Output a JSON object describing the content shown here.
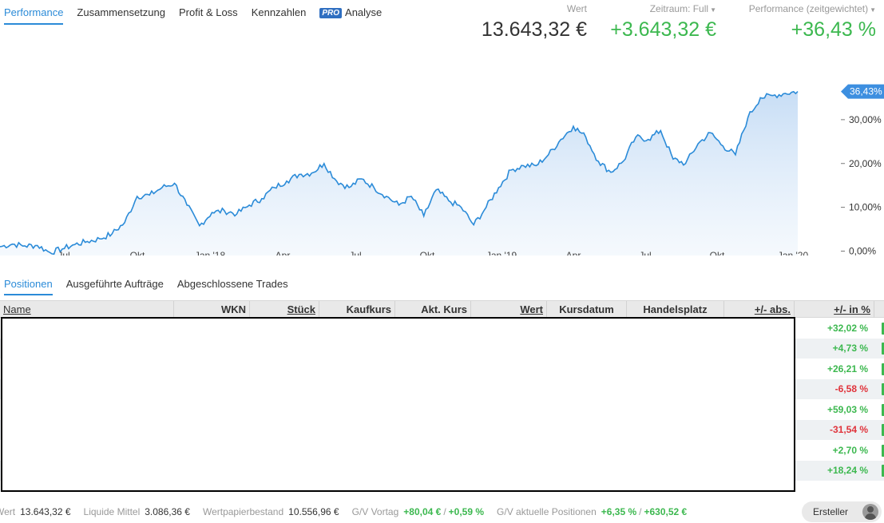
{
  "top_tabs": [
    "Performance",
    "Zusammensetzung",
    "Profit & Loss",
    "Kennzahlen",
    "Analyse"
  ],
  "pro_badge": "PRO",
  "stats": {
    "wert_label": "Wert",
    "wert_value": "13.643,32 €",
    "zeitraum_label": "Zeitraum: Full",
    "zeitraum_value": "+3.643,32 €",
    "performance_label": "Performance (zeitgewichtet)",
    "performance_value": "+36,43 %"
  },
  "chart_data": {
    "type": "area",
    "series": [
      {
        "values": [
          1.0,
          1.6,
          1.2,
          1.3,
          -0.3,
          0.5,
          1.5,
          2.2,
          2.8,
          4.0,
          6.5,
          12.5,
          12.8,
          14.5,
          15.5,
          10.5,
          5.8,
          8.8,
          9.2,
          8.5,
          10.5,
          12.0,
          14.5,
          16.0,
          17.5,
          17.8,
          20.0,
          16.0,
          14.5,
          16.5,
          14.5,
          12.5,
          10.5,
          12.5,
          8.0,
          14.0,
          11.5,
          10.0,
          6.0,
          10.0,
          14.5,
          18.5,
          19.5,
          19.5,
          22.0,
          25.5,
          28.5,
          26.0,
          20.5,
          18.0,
          20.5,
          26.0,
          25.5,
          27.5,
          21.0,
          20.0,
          24.5,
          27.0,
          24.0,
          22.0,
          30.5,
          35.0,
          35.5,
          36.0,
          36.43
        ]
      }
    ],
    "xticks": [
      "Jul",
      "Okt",
      "Jan '18",
      "Apr",
      "Jul",
      "Okt",
      "Jan '19",
      "Apr",
      "Jul",
      "Okt",
      "Jan '20"
    ],
    "yticks": [
      "0,00%",
      "10,00%",
      "20,00%",
      "30,00%"
    ],
    "ylim": [
      -1,
      40
    ],
    "current_label": "36,43%",
    "accent_color": "#2b8bd8"
  },
  "sub_tabs": [
    "Positionen",
    "Ausgeführte Aufträge",
    "Abgeschlossene Trades"
  ],
  "table": {
    "columns": [
      "Name",
      "WKN",
      "Stück",
      "Kaufkurs",
      "Akt. Kurs",
      "Wert",
      "Kursdatum",
      "Handelsplatz",
      "+/- abs.",
      "+/- in %"
    ],
    "pct_values": [
      "+32,02 %",
      "+4,73 %",
      "+26,21 %",
      "-6,58 %",
      "+59,03 %",
      "-31,54 %",
      "+2,70 %",
      "+18,24 %"
    ]
  },
  "footer": {
    "wert_label": "Wert",
    "wert_value": "13.643,32 €",
    "liquide_label": "Liquide Mittel",
    "liquide_value": "3.086,36 €",
    "bestand_label": "Wertpapierbestand",
    "bestand_value": "10.556,96 €",
    "vortag_label": "G/V Vortag",
    "vortag_abs": "+80,04 €",
    "vortag_pct": "+0,59 %",
    "aktuell_label": "G/V aktuelle Positionen",
    "aktuell_pct": "+6,35 %",
    "aktuell_abs": "+630,52 €",
    "separator": "/",
    "creator_label": "Ersteller"
  }
}
